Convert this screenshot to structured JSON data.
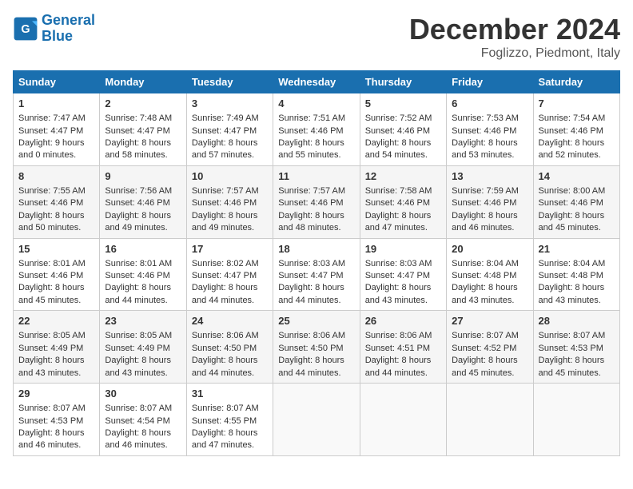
{
  "header": {
    "logo_line1": "General",
    "logo_line2": "Blue",
    "month": "December 2024",
    "location": "Foglizzo, Piedmont, Italy"
  },
  "days_of_week": [
    "Sunday",
    "Monday",
    "Tuesday",
    "Wednesday",
    "Thursday",
    "Friday",
    "Saturday"
  ],
  "weeks": [
    [
      {
        "day": "1",
        "info": "Sunrise: 7:47 AM\nSunset: 4:47 PM\nDaylight: 9 hours\nand 0 minutes."
      },
      {
        "day": "2",
        "info": "Sunrise: 7:48 AM\nSunset: 4:47 PM\nDaylight: 8 hours\nand 58 minutes."
      },
      {
        "day": "3",
        "info": "Sunrise: 7:49 AM\nSunset: 4:47 PM\nDaylight: 8 hours\nand 57 minutes."
      },
      {
        "day": "4",
        "info": "Sunrise: 7:51 AM\nSunset: 4:46 PM\nDaylight: 8 hours\nand 55 minutes."
      },
      {
        "day": "5",
        "info": "Sunrise: 7:52 AM\nSunset: 4:46 PM\nDaylight: 8 hours\nand 54 minutes."
      },
      {
        "day": "6",
        "info": "Sunrise: 7:53 AM\nSunset: 4:46 PM\nDaylight: 8 hours\nand 53 minutes."
      },
      {
        "day": "7",
        "info": "Sunrise: 7:54 AM\nSunset: 4:46 PM\nDaylight: 8 hours\nand 52 minutes."
      }
    ],
    [
      {
        "day": "8",
        "info": "Sunrise: 7:55 AM\nSunset: 4:46 PM\nDaylight: 8 hours\nand 50 minutes."
      },
      {
        "day": "9",
        "info": "Sunrise: 7:56 AM\nSunset: 4:46 PM\nDaylight: 8 hours\nand 49 minutes."
      },
      {
        "day": "10",
        "info": "Sunrise: 7:57 AM\nSunset: 4:46 PM\nDaylight: 8 hours\nand 49 minutes."
      },
      {
        "day": "11",
        "info": "Sunrise: 7:57 AM\nSunset: 4:46 PM\nDaylight: 8 hours\nand 48 minutes."
      },
      {
        "day": "12",
        "info": "Sunrise: 7:58 AM\nSunset: 4:46 PM\nDaylight: 8 hours\nand 47 minutes."
      },
      {
        "day": "13",
        "info": "Sunrise: 7:59 AM\nSunset: 4:46 PM\nDaylight: 8 hours\nand 46 minutes."
      },
      {
        "day": "14",
        "info": "Sunrise: 8:00 AM\nSunset: 4:46 PM\nDaylight: 8 hours\nand 45 minutes."
      }
    ],
    [
      {
        "day": "15",
        "info": "Sunrise: 8:01 AM\nSunset: 4:46 PM\nDaylight: 8 hours\nand 45 minutes."
      },
      {
        "day": "16",
        "info": "Sunrise: 8:01 AM\nSunset: 4:46 PM\nDaylight: 8 hours\nand 44 minutes."
      },
      {
        "day": "17",
        "info": "Sunrise: 8:02 AM\nSunset: 4:47 PM\nDaylight: 8 hours\nand 44 minutes."
      },
      {
        "day": "18",
        "info": "Sunrise: 8:03 AM\nSunset: 4:47 PM\nDaylight: 8 hours\nand 44 minutes."
      },
      {
        "day": "19",
        "info": "Sunrise: 8:03 AM\nSunset: 4:47 PM\nDaylight: 8 hours\nand 43 minutes."
      },
      {
        "day": "20",
        "info": "Sunrise: 8:04 AM\nSunset: 4:48 PM\nDaylight: 8 hours\nand 43 minutes."
      },
      {
        "day": "21",
        "info": "Sunrise: 8:04 AM\nSunset: 4:48 PM\nDaylight: 8 hours\nand 43 minutes."
      }
    ],
    [
      {
        "day": "22",
        "info": "Sunrise: 8:05 AM\nSunset: 4:49 PM\nDaylight: 8 hours\nand 43 minutes."
      },
      {
        "day": "23",
        "info": "Sunrise: 8:05 AM\nSunset: 4:49 PM\nDaylight: 8 hours\nand 43 minutes."
      },
      {
        "day": "24",
        "info": "Sunrise: 8:06 AM\nSunset: 4:50 PM\nDaylight: 8 hours\nand 44 minutes."
      },
      {
        "day": "25",
        "info": "Sunrise: 8:06 AM\nSunset: 4:50 PM\nDaylight: 8 hours\nand 44 minutes."
      },
      {
        "day": "26",
        "info": "Sunrise: 8:06 AM\nSunset: 4:51 PM\nDaylight: 8 hours\nand 44 minutes."
      },
      {
        "day": "27",
        "info": "Sunrise: 8:07 AM\nSunset: 4:52 PM\nDaylight: 8 hours\nand 45 minutes."
      },
      {
        "day": "28",
        "info": "Sunrise: 8:07 AM\nSunset: 4:53 PM\nDaylight: 8 hours\nand 45 minutes."
      }
    ],
    [
      {
        "day": "29",
        "info": "Sunrise: 8:07 AM\nSunset: 4:53 PM\nDaylight: 8 hours\nand 46 minutes."
      },
      {
        "day": "30",
        "info": "Sunrise: 8:07 AM\nSunset: 4:54 PM\nDaylight: 8 hours\nand 46 minutes."
      },
      {
        "day": "31",
        "info": "Sunrise: 8:07 AM\nSunset: 4:55 PM\nDaylight: 8 hours\nand 47 minutes."
      },
      {
        "day": "",
        "info": ""
      },
      {
        "day": "",
        "info": ""
      },
      {
        "day": "",
        "info": ""
      },
      {
        "day": "",
        "info": ""
      }
    ]
  ]
}
